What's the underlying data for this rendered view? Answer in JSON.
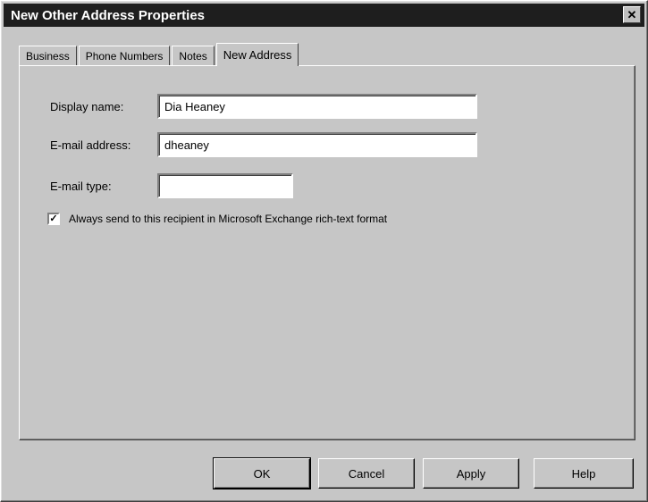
{
  "window": {
    "title": "New Other Address Properties",
    "close_label": "✕"
  },
  "tabs": [
    {
      "label": "Business"
    },
    {
      "label": "Phone Numbers"
    },
    {
      "label": "Notes"
    },
    {
      "label": "New Address"
    }
  ],
  "form": {
    "display_name_label": "Display name:",
    "display_name_value": "Dia Heaney",
    "email_address_label": "E-mail address:",
    "email_address_value": "dheaney",
    "email_type_label": "E-mail type:",
    "email_type_value": "",
    "rich_text_checked": true,
    "rich_text_label": "Always send to this recipient in Microsoft Exchange rich-text format"
  },
  "buttons": {
    "ok": "OK",
    "cancel": "Cancel",
    "apply": "Apply",
    "help": "Help"
  }
}
